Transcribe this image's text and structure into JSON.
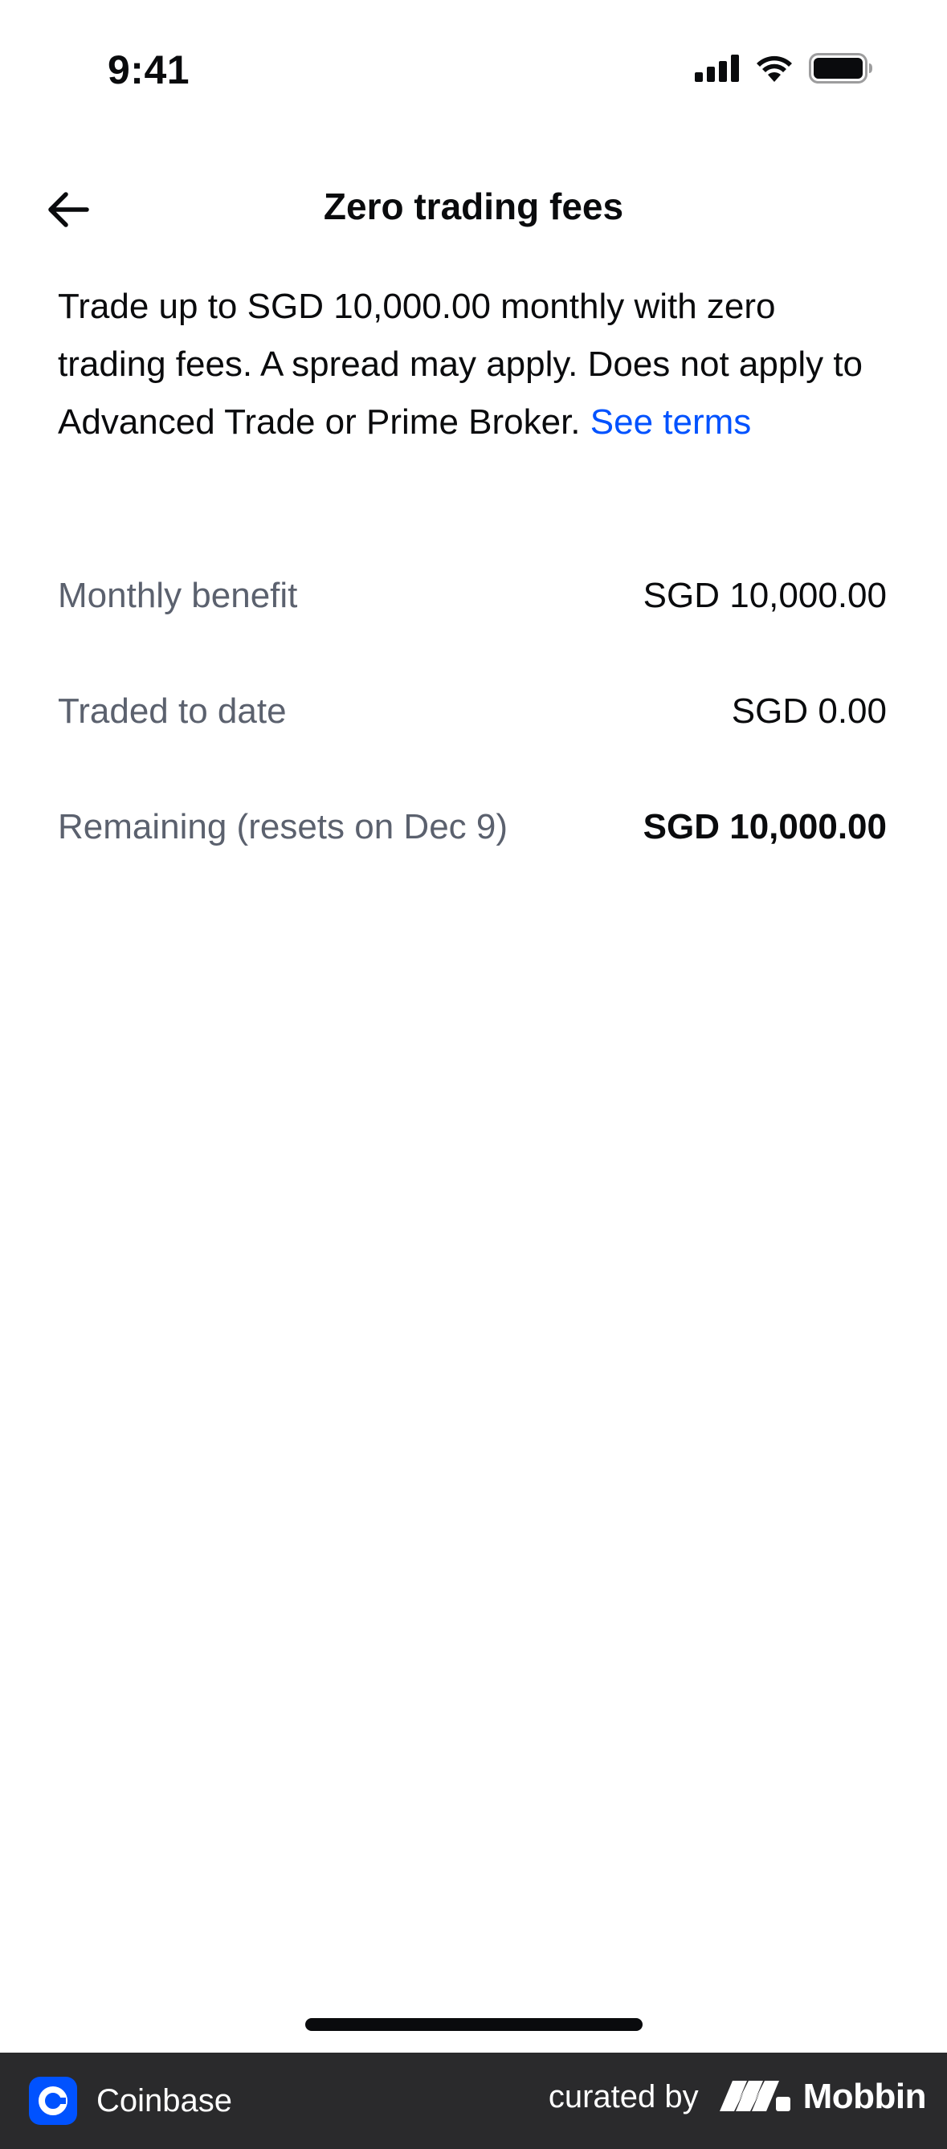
{
  "status_bar": {
    "time": "9:41",
    "icons": [
      "cellular-signal-icon",
      "wifi-icon",
      "battery-icon"
    ]
  },
  "nav": {
    "back_icon": "arrow-left-icon",
    "title": "Zero trading fees"
  },
  "description": {
    "text": "Trade up to SGD 10,000.00 monthly with zero trading fees. A spread may apply. Does not apply to Advanced Trade or Prime Broker.",
    "link_text": "See terms"
  },
  "rows": [
    {
      "label": "Monthly benefit",
      "value": "SGD 10,000.00"
    },
    {
      "label": "Traded to date",
      "value": "SGD 0.00"
    },
    {
      "label": "Remaining (resets on Dec 9)",
      "value": "SGD 10,000.00"
    }
  ],
  "footer": {
    "app_name": "Coinbase",
    "curated_by": "curated by",
    "brand": "Mobbin"
  },
  "colors": {
    "link": "#0052ff",
    "label": "#5b616e",
    "text": "#0a0b0d",
    "footer_bg": "#2a2a2c",
    "coinbase_blue": "#0052ff"
  }
}
